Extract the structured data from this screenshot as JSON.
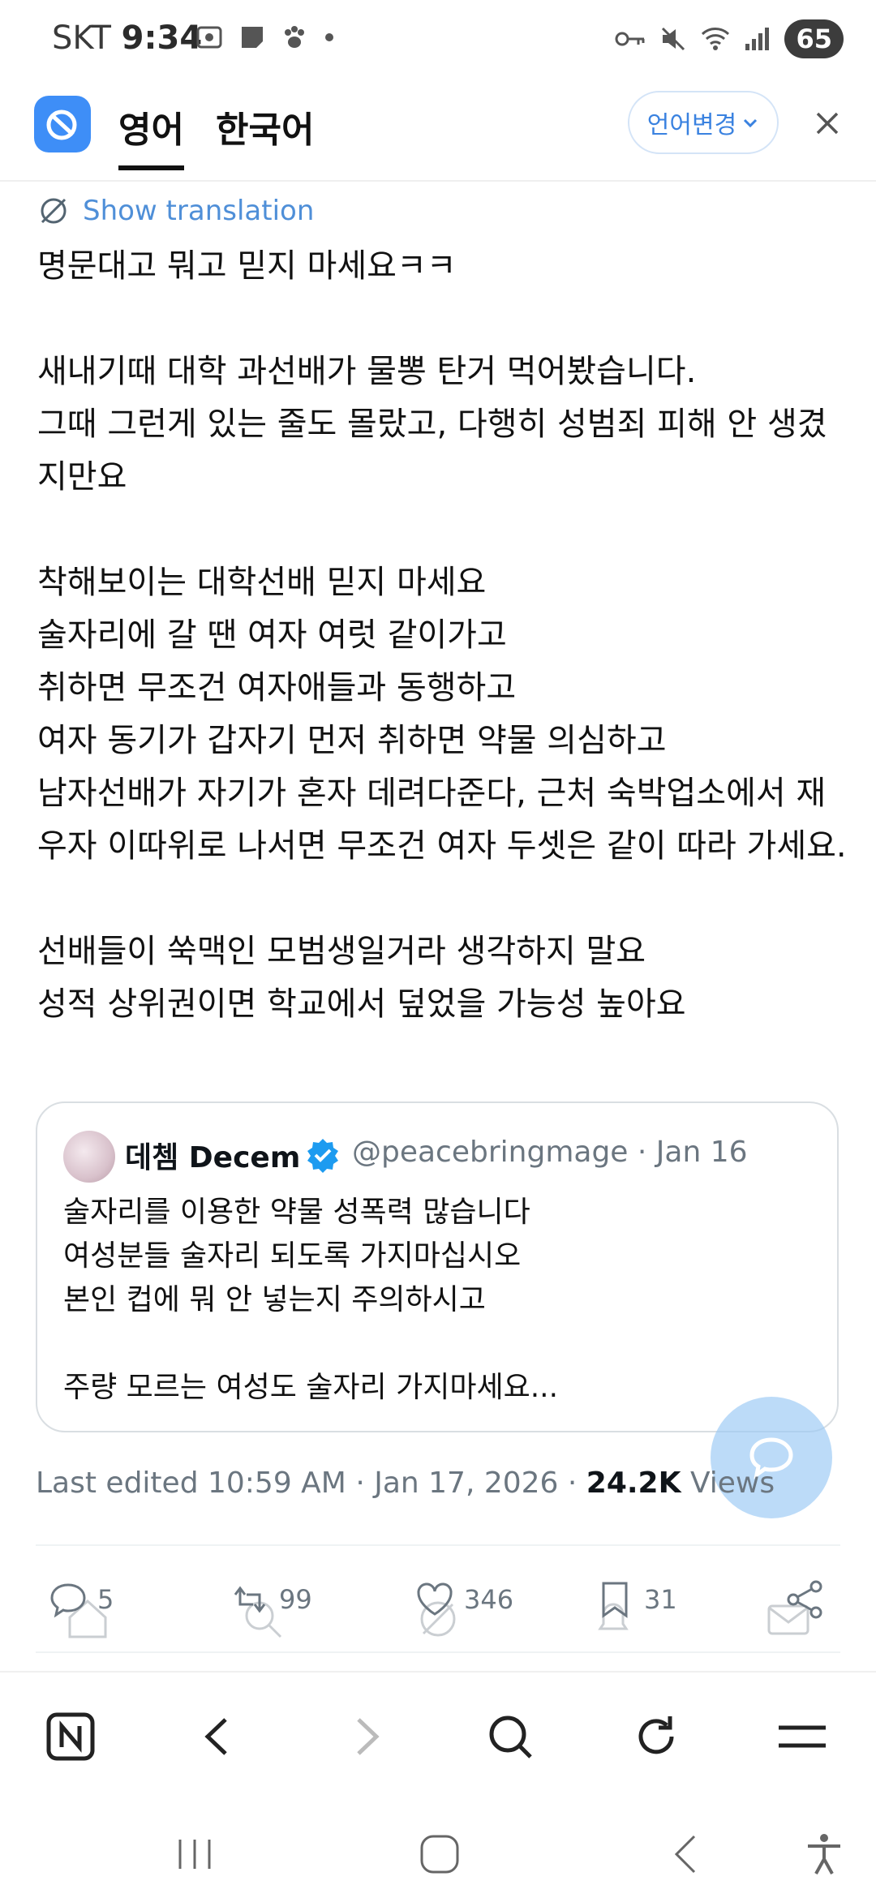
{
  "status_bar": {
    "carrier": "SKT",
    "time": "9:34",
    "battery": "65"
  },
  "translator": {
    "tab_source": "영어",
    "tab_target": "한국어",
    "change_language": "언어변경"
  },
  "tweet": {
    "show_translation": "Show translation",
    "text": "명문대고 뭐고 믿지 마세요ㅋㅋ\n\n새내기때 대학 과선배가 물뽕 탄거 먹어봤습니다.\n그때 그런게 있는 줄도 몰랐고, 다행히 성범죄 피해 안 생겼지만요\n\n착해보이는 대학선배 믿지 마세요\n술자리에 갈 땐 여자 여럿 같이가고\n취하면 무조건 여자애들과 동행하고\n여자 동기가 갑자기 먼저 취하면 약물 의심하고\n남자선배가 자기가 혼자 데려다준다, 근처 숙박업소에서 재우자 이따위로 나서면 무조건 여자 두셋은 같이 따라 가세요.\n\n선배들이 쑥맥인 모범생일거라 생각하지 말요\n성적 상위권이면 학교에서 덮었을 가능성 높아요",
    "quote": {
      "name": "데쳄 Decem",
      "handle_date": "@peacebringmage · Jan 16",
      "text": "술자리를 이용한 약물 성폭력 많습니다\n여성분들 술자리 되도록 가지마십시오\n본인 컵에 뭐 안 넣는지 주의하시고\n\n주량 모르는 여성도 술자리 가지마세요..."
    },
    "meta_prefix": "Last edited 10:59 AM · Jan 17, 2026 · ",
    "views_count": "24.2K",
    "views_label": " Views",
    "actions": {
      "replies": "5",
      "reposts": "99",
      "likes": "346",
      "bookmarks": "31"
    }
  },
  "colors": {
    "accent": "#1d9bf0",
    "translator_blue": "#3e8ef7"
  }
}
